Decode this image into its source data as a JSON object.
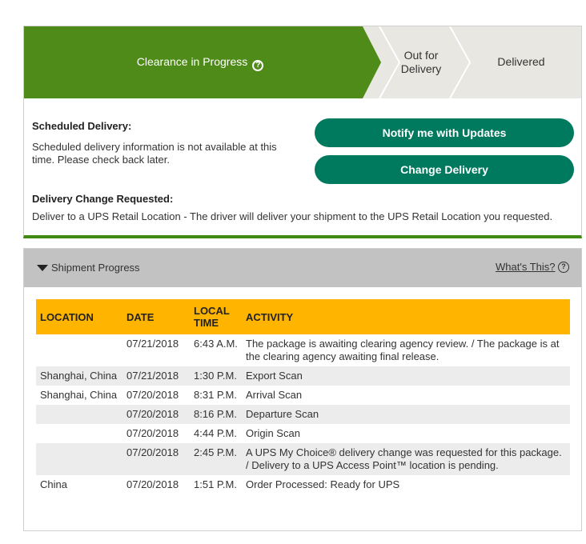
{
  "progress": {
    "current_step": "Clearance in Progress",
    "help_symbol": "?",
    "step2": "Out for Delivery",
    "step3": "Delivered",
    "colors": {
      "active": "#4e8b18",
      "inactive": "#e8e7e2"
    }
  },
  "scheduled": {
    "title": "Scheduled Delivery:",
    "text": "Scheduled delivery information is not available at this time. Please check back later."
  },
  "buttons": {
    "notify": "Notify me with Updates",
    "change": "Change Delivery",
    "color": "#007a5e"
  },
  "change_requested": {
    "title": "Delivery Change Requested:",
    "text": "Deliver to a UPS Retail Location - The driver will deliver your shipment to the UPS Retail Location you requested."
  },
  "shipment": {
    "title": "Shipment Progress",
    "whats_this": "What's This?",
    "help_symbol": "?",
    "columns": [
      "LOCATION",
      "DATE",
      "LOCAL TIME",
      "ACTIVITY"
    ],
    "rows": [
      {
        "location": "",
        "date": "07/21/2018",
        "time": "6:43 A.M.",
        "activity": "The package is awaiting clearing agency review. / The package is at the clearing agency awaiting final release."
      },
      {
        "location": "Shanghai, China",
        "date": "07/21/2018",
        "time": "1:30 P.M.",
        "activity": "Export Scan"
      },
      {
        "location": "Shanghai, China",
        "date": "07/20/2018",
        "time": "8:31 P.M.",
        "activity": "Arrival Scan"
      },
      {
        "location": "",
        "date": "07/20/2018",
        "time": "8:16 P.M.",
        "activity": "Departure Scan"
      },
      {
        "location": "",
        "date": "07/20/2018",
        "time": "4:44 P.M.",
        "activity": "Origin Scan"
      },
      {
        "location": "",
        "date": "07/20/2018",
        "time": "2:45 P.M.",
        "activity": "A UPS My Choice® delivery change was requested for this package. / Delivery to a UPS Access Point™ location is pending."
      },
      {
        "location": "China",
        "date": "07/20/2018",
        "time": "1:51 P.M.",
        "activity": "Order Processed: Ready for UPS"
      }
    ]
  }
}
